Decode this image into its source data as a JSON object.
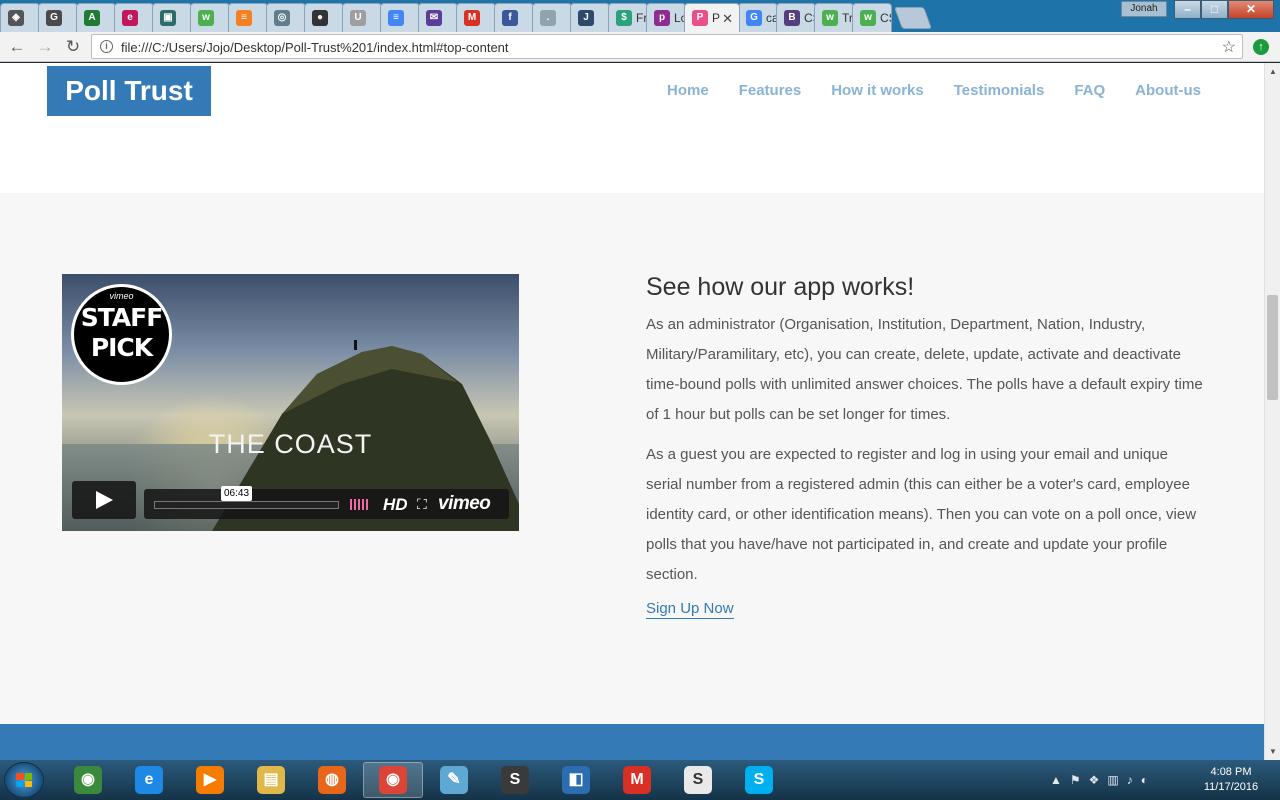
{
  "browser": {
    "tabs": [
      {
        "icon": "codepen-icon",
        "color": "#555555",
        "glyph": "◈",
        "title": ""
      },
      {
        "icon": "document-icon",
        "color": "#4a4a4a",
        "glyph": "G",
        "title": ""
      },
      {
        "icon": "sheet-icon",
        "color": "#1f7a36",
        "glyph": "A",
        "title": ""
      },
      {
        "icon": "edx-icon",
        "color": "#c2185b",
        "glyph": "e",
        "title": ""
      },
      {
        "icon": "monitor-icon",
        "color": "#2e6b6b",
        "glyph": "▣",
        "title": ""
      },
      {
        "icon": "w3schools-icon",
        "color": "#4caf50",
        "glyph": "w",
        "title": ""
      },
      {
        "icon": "stackoverflow-icon",
        "color": "#f48024",
        "glyph": "≡",
        "title": ""
      },
      {
        "icon": "spiral-icon",
        "color": "#607d8b",
        "glyph": "◎",
        "title": ""
      },
      {
        "icon": "github-icon",
        "color": "#333333",
        "glyph": "●",
        "title": ""
      },
      {
        "icon": "udacity-icon",
        "color": "#9e9e9e",
        "glyph": "U",
        "title": ""
      },
      {
        "icon": "google-docs-icon",
        "color": "#4285f4",
        "glyph": "≡",
        "title": ""
      },
      {
        "icon": "mail-icon",
        "color": "#5b3d99",
        "glyph": "✉",
        "title": ""
      },
      {
        "icon": "gmail-icon",
        "color": "#d93025",
        "glyph": "M",
        "title": ""
      },
      {
        "icon": "facebook-icon",
        "color": "#3b5998",
        "glyph": "f",
        "title": ""
      },
      {
        "icon": "dot-icon",
        "color": "#90a4ae",
        "glyph": ".",
        "title": ""
      },
      {
        "icon": "j-icon",
        "color": "#2d4a6b",
        "glyph": "J",
        "title": ""
      },
      {
        "icon": "dollar-icon",
        "color": "#2aa27a",
        "glyph": "$",
        "title": "Fror"
      },
      {
        "icon": "p-icon",
        "color": "#8e2c8f",
        "glyph": "p",
        "title": "Logi"
      },
      {
        "icon": "poll-trust-icon",
        "color": "#e94f8a",
        "glyph": "P",
        "title": "P",
        "active": true
      },
      {
        "icon": "google-icon",
        "color": "#4285f4",
        "glyph": "G",
        "title": "carc"
      },
      {
        "icon": "bootstrap-icon",
        "color": "#563d7c",
        "glyph": "B",
        "title": "CSS"
      },
      {
        "icon": "w3schools-icon",
        "color": "#4caf50",
        "glyph": "w",
        "title": "Tryi"
      },
      {
        "icon": "w3schools-icon",
        "color": "#4caf50",
        "glyph": "w",
        "title": "CSS"
      }
    ],
    "profile": "Jonah",
    "url": "file:///C:/Users/Jojo/Desktop/Poll-Trust%201/index.html#top-content"
  },
  "site": {
    "logo": "Poll Trust",
    "nav": [
      "Home",
      "Features",
      "How it works",
      "Testimonials",
      "FAQ",
      "About-us"
    ]
  },
  "section": {
    "heading": "See how our app works!",
    "paragraph1": "As an administrator (Organisation, Institution, Department, Nation, Industry, Military/Paramilitary, etc), you can create, delete, update, activate and deactivate time-bound polls with unlimited answer choices. The polls have a default expiry time of 1 hour but polls can be set longer for times.",
    "paragraph2": "As a guest you are expected to register and log in using your email and unique serial number from a registered admin (this can either be a voter's card, employee identity card, or other identification means). Then you can vote on a poll once, view polls that you have/have not participated in, and create and update your profile section.",
    "cta": "Sign Up Now"
  },
  "video": {
    "badge_top": "vimeo",
    "badge_main_1": "STAFF",
    "badge_main_2": "PICK",
    "title": "THE COAST",
    "duration": "06:43",
    "hd": "HD",
    "brand": "vimeo"
  },
  "taskbar": {
    "apps": [
      {
        "name": "windows-explorer",
        "icon": "explorer-icon",
        "color": "#3b8a3b",
        "glyph": "◉"
      },
      {
        "name": "internet-explorer",
        "icon": "ie-icon",
        "color": "#1e88e5",
        "glyph": "e"
      },
      {
        "name": "media-player",
        "icon": "media-player-icon",
        "color": "#f57c00",
        "glyph": "▶"
      },
      {
        "name": "file-explorer",
        "icon": "folder-icon",
        "color": "#e0b84a",
        "glyph": "▤"
      },
      {
        "name": "firefox",
        "icon": "firefox-icon",
        "color": "#e8661a",
        "glyph": "◍"
      },
      {
        "name": "chrome",
        "icon": "chrome-icon",
        "color": "#db4437",
        "glyph": "◉",
        "active": true
      },
      {
        "name": "notepad",
        "icon": "pad-icon",
        "color": "#5fa8d3",
        "glyph": "✎"
      },
      {
        "name": "sublime-text",
        "icon": "sublime-icon",
        "color": "#3a3a3a",
        "glyph": "S"
      },
      {
        "name": "visual-studio",
        "icon": "vs-icon",
        "color": "#2a6db0",
        "glyph": "◧"
      },
      {
        "name": "gmail",
        "icon": "gmail-icon",
        "color": "#d93025",
        "glyph": "M"
      },
      {
        "name": "slack",
        "icon": "slack-icon",
        "color": "#e9e9e9",
        "glyph": "S"
      },
      {
        "name": "skype",
        "icon": "skype-icon",
        "color": "#00aff0",
        "glyph": "S"
      }
    ],
    "time": "4:08 PM",
    "date": "11/17/2016"
  }
}
